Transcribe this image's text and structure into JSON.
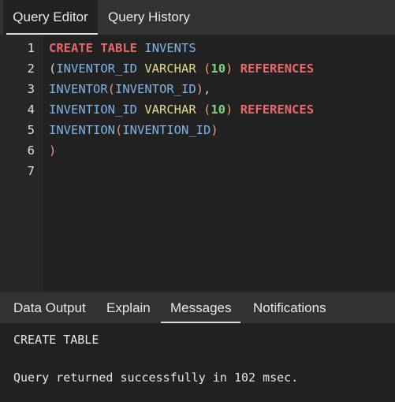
{
  "editor_tabs": [
    "Query Editor",
    "Query History"
  ],
  "active_editor_tab": "Query Editor",
  "line_numbers": [
    "1",
    "2",
    "3",
    "4",
    "5",
    "6",
    "7"
  ],
  "code": {
    "l1": {
      "kw1": "CREATE",
      "kw2": "TABLE",
      "name": "INVENTS"
    },
    "l2": {
      "open": "(",
      "col": "INVENTOR_ID",
      "type": "VARCHAR",
      "p1": "(",
      "num": "10",
      "p2": ")",
      "ref": "REFERENCES"
    },
    "l3": {
      "tbl": "INVENTOR",
      "p1": "(",
      "col": "INVENTOR_ID",
      "p2": ")",
      "comma": ","
    },
    "l4": {
      "col": "INVENTION_ID",
      "type": "VARCHAR",
      "p1": "(",
      "num": "10",
      "p2": ")",
      "ref": "REFERENCES"
    },
    "l5": {
      "tbl": "INVENTION",
      "p1": "(",
      "col": "INVENTION_ID",
      "p2": ")"
    },
    "l6": {
      "close": ")"
    }
  },
  "output_tabs": [
    "Data Output",
    "Explain",
    "Messages",
    "Notifications"
  ],
  "active_output_tab": "Messages",
  "messages": {
    "line1": "CREATE TABLE",
    "line2": "Query returned successfully in 102 msec."
  },
  "colors": {
    "keyword": "#e8676b",
    "identifier": "#7fb4e4",
    "type": "#e5d88a",
    "number": "#7ed67a",
    "paren": "#e79a73",
    "background": "#222222"
  }
}
